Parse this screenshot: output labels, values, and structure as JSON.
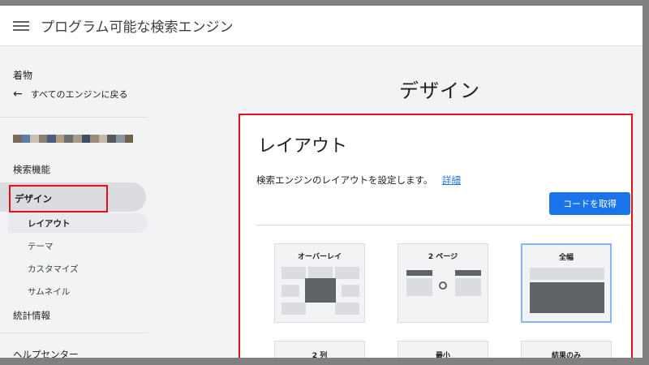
{
  "header": {
    "title": "プログラム可能な検索エンジン",
    "menu_icon": "hamburger-menu-icon"
  },
  "sidebar": {
    "section_title": "着物",
    "back_link": "すべてのエンジンに戻る",
    "items": [
      {
        "label": "検索機能"
      },
      {
        "label": "デザイン",
        "active": true
      },
      {
        "label": "統計情報"
      },
      {
        "label": "ヘルプセンター"
      }
    ],
    "design_subitems": [
      {
        "label": "レイアウト",
        "active": true
      },
      {
        "label": "テーマ"
      },
      {
        "label": "カスタマイズ"
      },
      {
        "label": "サムネイル"
      }
    ],
    "thumbnail_colors": [
      "#7a6a5c",
      "#5c7da8",
      "#c9c0b3",
      "#8a8174",
      "#4a5f7a",
      "#b59b83",
      "#6e6e6e",
      "#a39a8a",
      "#3f4f63",
      "#9c8b7a",
      "#c4b8a8",
      "#5a5a5a",
      "#8a94a3",
      "#70614f"
    ]
  },
  "main": {
    "page_title": "デザイン",
    "card": {
      "title": "レイアウト",
      "description": "検索エンジンのレイアウトを設定します。",
      "details_link": "詳細",
      "get_code_button": "コードを取得",
      "layouts": [
        {
          "label": "オーバーレイ",
          "selected": false
        },
        {
          "label": "2 ページ",
          "selected": false
        },
        {
          "label": "全幅",
          "selected": true
        },
        {
          "label": "2 列",
          "selected": false
        },
        {
          "label": "最小",
          "selected": false
        },
        {
          "label": "結果のみ",
          "selected": false
        }
      ]
    }
  },
  "colors": {
    "accent": "#1a73e8",
    "highlight_box": "#e4111a",
    "selected_border": "#8ab4f8"
  }
}
